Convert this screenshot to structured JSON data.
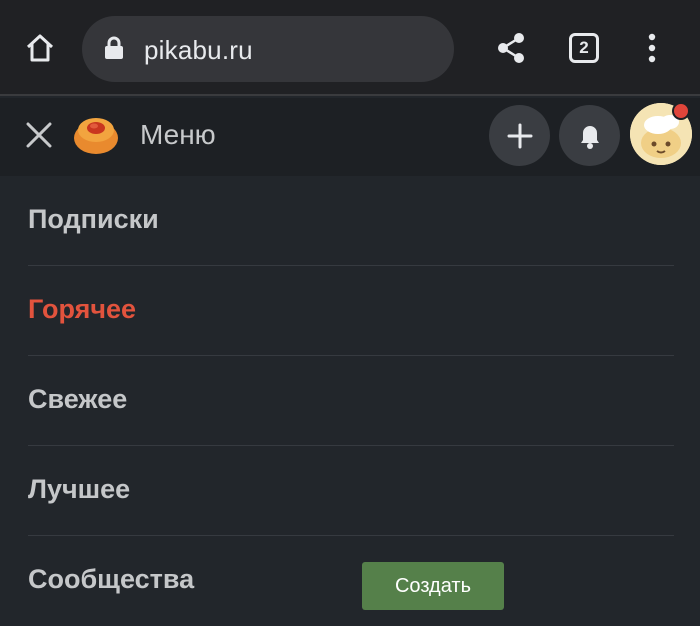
{
  "browser": {
    "url": "pikabu.ru",
    "tab_count": "2"
  },
  "header": {
    "title": "Меню"
  },
  "menu": {
    "items": [
      {
        "label": "Подписки"
      },
      {
        "label": "Горячее"
      },
      {
        "label": "Свежее"
      },
      {
        "label": "Лучшее"
      },
      {
        "label": "Сообщества"
      }
    ],
    "create_label": "Создать"
  },
  "colors": {
    "active_item": "#e2533d",
    "create_button": "#55804a",
    "notification_dot": "#e0453a"
  }
}
